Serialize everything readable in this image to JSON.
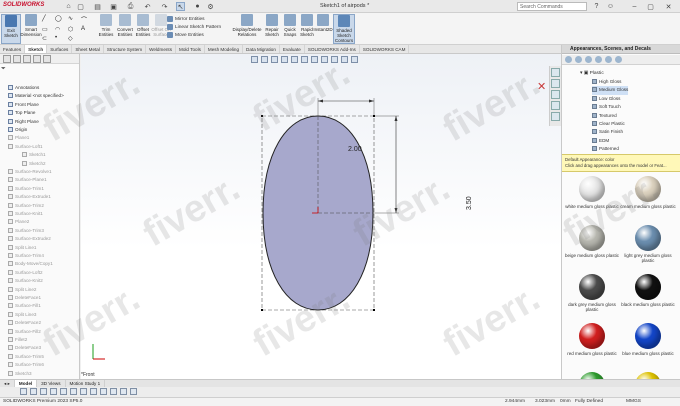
{
  "titlebar": {
    "logo_text": "SOLIDWORKS",
    "document_title": "Sketch1 of airpods *",
    "search_placeholder": "Search Commands"
  },
  "ribbon": {
    "buttons": [
      {
        "label": "Exit Sketch",
        "icon": "exit-sketch-icon"
      },
      {
        "label": "Smart Dimension",
        "icon": "smart-dimension-icon"
      },
      {
        "label": "Trim Entities",
        "icon": "trim-icon"
      },
      {
        "label": "Convert Entities",
        "icon": "convert-icon"
      },
      {
        "label": "Offset Entities",
        "icon": "offset-icon"
      },
      {
        "label": "Offset On Surface",
        "icon": "offset-surface-icon"
      },
      {
        "label": "Display/Delete Relations",
        "icon": "relations-icon"
      },
      {
        "label": "Repair Sketch",
        "icon": "repair-icon"
      },
      {
        "label": "Quick Snaps",
        "icon": "snap-icon"
      },
      {
        "label": "Rapid Sketch",
        "icon": "rapid-sketch-icon"
      },
      {
        "label": "Instant2D",
        "icon": "instant2d-icon"
      },
      {
        "label": "Shaded Sketch Contours",
        "icon": "shaded-icon"
      }
    ],
    "small_rows": [
      "Mirror Entities",
      "Linear Sketch Pattern",
      "Move Entities"
    ]
  },
  "tabs": [
    "Features",
    "Sketch",
    "Surfaces",
    "Sheet Metal",
    "Structure System",
    "Weldments",
    "Mold Tools",
    "Mesh Modeling",
    "Data Migration",
    "Evaluate",
    "SOLIDWORKS Add-Ins",
    "SOLIDWORKS CAM"
  ],
  "tree": [
    {
      "label": "Annotations",
      "gray": false
    },
    {
      "label": "Material <not specified>",
      "gray": false
    },
    {
      "label": "Front Plane",
      "gray": false
    },
    {
      "label": "Top Plane",
      "gray": false
    },
    {
      "label": "Right Plane",
      "gray": false
    },
    {
      "label": "Origin",
      "gray": false
    },
    {
      "label": "Plane1",
      "gray": true
    },
    {
      "label": "Surface-Loft1",
      "gray": true
    },
    {
      "label": "Sketch1",
      "gray": true
    },
    {
      "label": "Sketch2",
      "gray": true
    },
    {
      "label": "Surface-Revolve1",
      "gray": true
    },
    {
      "label": "Surface-Plane1",
      "gray": true
    },
    {
      "label": "Surface-Trim1",
      "gray": true
    },
    {
      "label": "Surface-Extrude1",
      "gray": true
    },
    {
      "label": "Surface-Trim2",
      "gray": true
    },
    {
      "label": "Surface-Knit1",
      "gray": true
    },
    {
      "label": "Plane2",
      "gray": true
    },
    {
      "label": "Surface-Trim3",
      "gray": true
    },
    {
      "label": "Surface-Extrude2",
      "gray": true
    },
    {
      "label": "Split Line1",
      "gray": true
    },
    {
      "label": "Surface-Trim4",
      "gray": true
    },
    {
      "label": "Body-Move/Copy1",
      "gray": true
    },
    {
      "label": "Surface-Loft2",
      "gray": true
    },
    {
      "label": "Surface-Knit2",
      "gray": true
    },
    {
      "label": "Split Line2",
      "gray": true
    },
    {
      "label": "DeleteFace1",
      "gray": true
    },
    {
      "label": "Surface-Fill1",
      "gray": true
    },
    {
      "label": "Split Line3",
      "gray": true
    },
    {
      "label": "DeleteFace2",
      "gray": true
    },
    {
      "label": "Surface-Fill2",
      "gray": true
    },
    {
      "label": "Fillet2",
      "gray": true
    },
    {
      "label": "DeleteFace3",
      "gray": true
    },
    {
      "label": "Surface-Trim5",
      "gray": true
    },
    {
      "label": "Surface-Trim6",
      "gray": true
    },
    {
      "label": "Sketch3",
      "gray": true
    }
  ],
  "viewport": {
    "dim_width": "2.00",
    "dim_height": "3.50",
    "view_label": "*Front"
  },
  "rightpanel": {
    "title": "Appearances, Scenes, and Decals",
    "category": "Plastic",
    "materials": [
      "High Gloss",
      "Medium Gloss",
      "Low Gloss",
      "Soft Touch",
      "Textured",
      "Clear Plastic",
      "Satin Finish",
      "EDM",
      "Patterned"
    ],
    "selected_material": 1,
    "default_label": "Default Appearance: color",
    "tooltip": "Click and drag appearances onto the model or Feat...",
    "swatches": [
      {
        "label": "white medium gloss plastic",
        "color": "#e8e8e8"
      },
      {
        "label": "cream medium gloss plastic",
        "color": "#ddd3c0"
      },
      {
        "label": "beige medium gloss plastic",
        "color": "#b8b8b0"
      },
      {
        "label": "light grey medium gloss plastic",
        "color": "#6c8fb0"
      },
      {
        "label": "dark grey medium gloss plastic",
        "color": "#4c4c4c"
      },
      {
        "label": "black medium gloss plastic",
        "color": "#111111"
      },
      {
        "label": "red medium gloss plastic",
        "color": "#d21f1f"
      },
      {
        "label": "blue medium gloss plastic",
        "color": "#1346c9"
      },
      {
        "label": "",
        "color": "#2f9e2f"
      },
      {
        "label": "",
        "color": "#e0c400"
      }
    ]
  },
  "bottom_tabs": [
    "Model",
    "3D Views",
    "Motion Study 1"
  ],
  "status": {
    "app": "SOLIDWORKS Premium 2023 SP5.0",
    "x": "2.944mm",
    "y": "3.023mm",
    "z": "0mm",
    "mode": "Fully Defined",
    "units": "MMGS"
  },
  "watermark_text": "fiverr."
}
